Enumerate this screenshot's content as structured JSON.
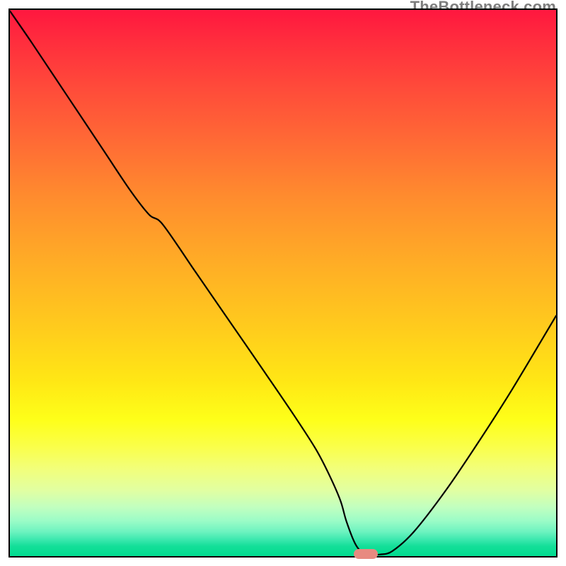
{
  "watermark": "TheBottleneck.com",
  "chart_data": {
    "type": "line",
    "title": "",
    "xlabel": "",
    "ylabel": "",
    "x_range": [
      0,
      100
    ],
    "y_range": [
      0,
      100
    ],
    "grid": false,
    "legend": false,
    "series": [
      {
        "name": "curve",
        "x": [
          0.0,
          4.0,
          10.0,
          17.0,
          22.0,
          25.5,
          28.0,
          34.0,
          40.0,
          46.0,
          52.0,
          56.0,
          58.4,
          60.5,
          61.6,
          63.2,
          64.6,
          66.2,
          67.8,
          70.0,
          74.0,
          80.0,
          86.0,
          92.0,
          100.0
        ],
        "y": [
          99.8,
          94.0,
          85.0,
          74.5,
          67.0,
          62.5,
          60.7,
          52.0,
          43.3,
          34.6,
          25.8,
          19.6,
          15.0,
          10.2,
          6.4,
          2.3,
          0.6,
          0.3,
          0.3,
          0.9,
          4.5,
          12.3,
          21.2,
          30.6,
          44.0
        ]
      }
    ],
    "flat_bottom": {
      "x_start": 61.8,
      "x_end": 68.2,
      "y": 0.35
    },
    "marker": {
      "x": 65.2,
      "y": 0.35,
      "color": "#e88a80"
    },
    "background_gradient": {
      "stops": [
        {
          "pos": 0.0,
          "color": "#ff173f"
        },
        {
          "pos": 0.46,
          "color": "#ffac26"
        },
        {
          "pos": 0.75,
          "color": "#feff19"
        },
        {
          "pos": 1.0,
          "color": "#00da8f"
        }
      ]
    }
  }
}
